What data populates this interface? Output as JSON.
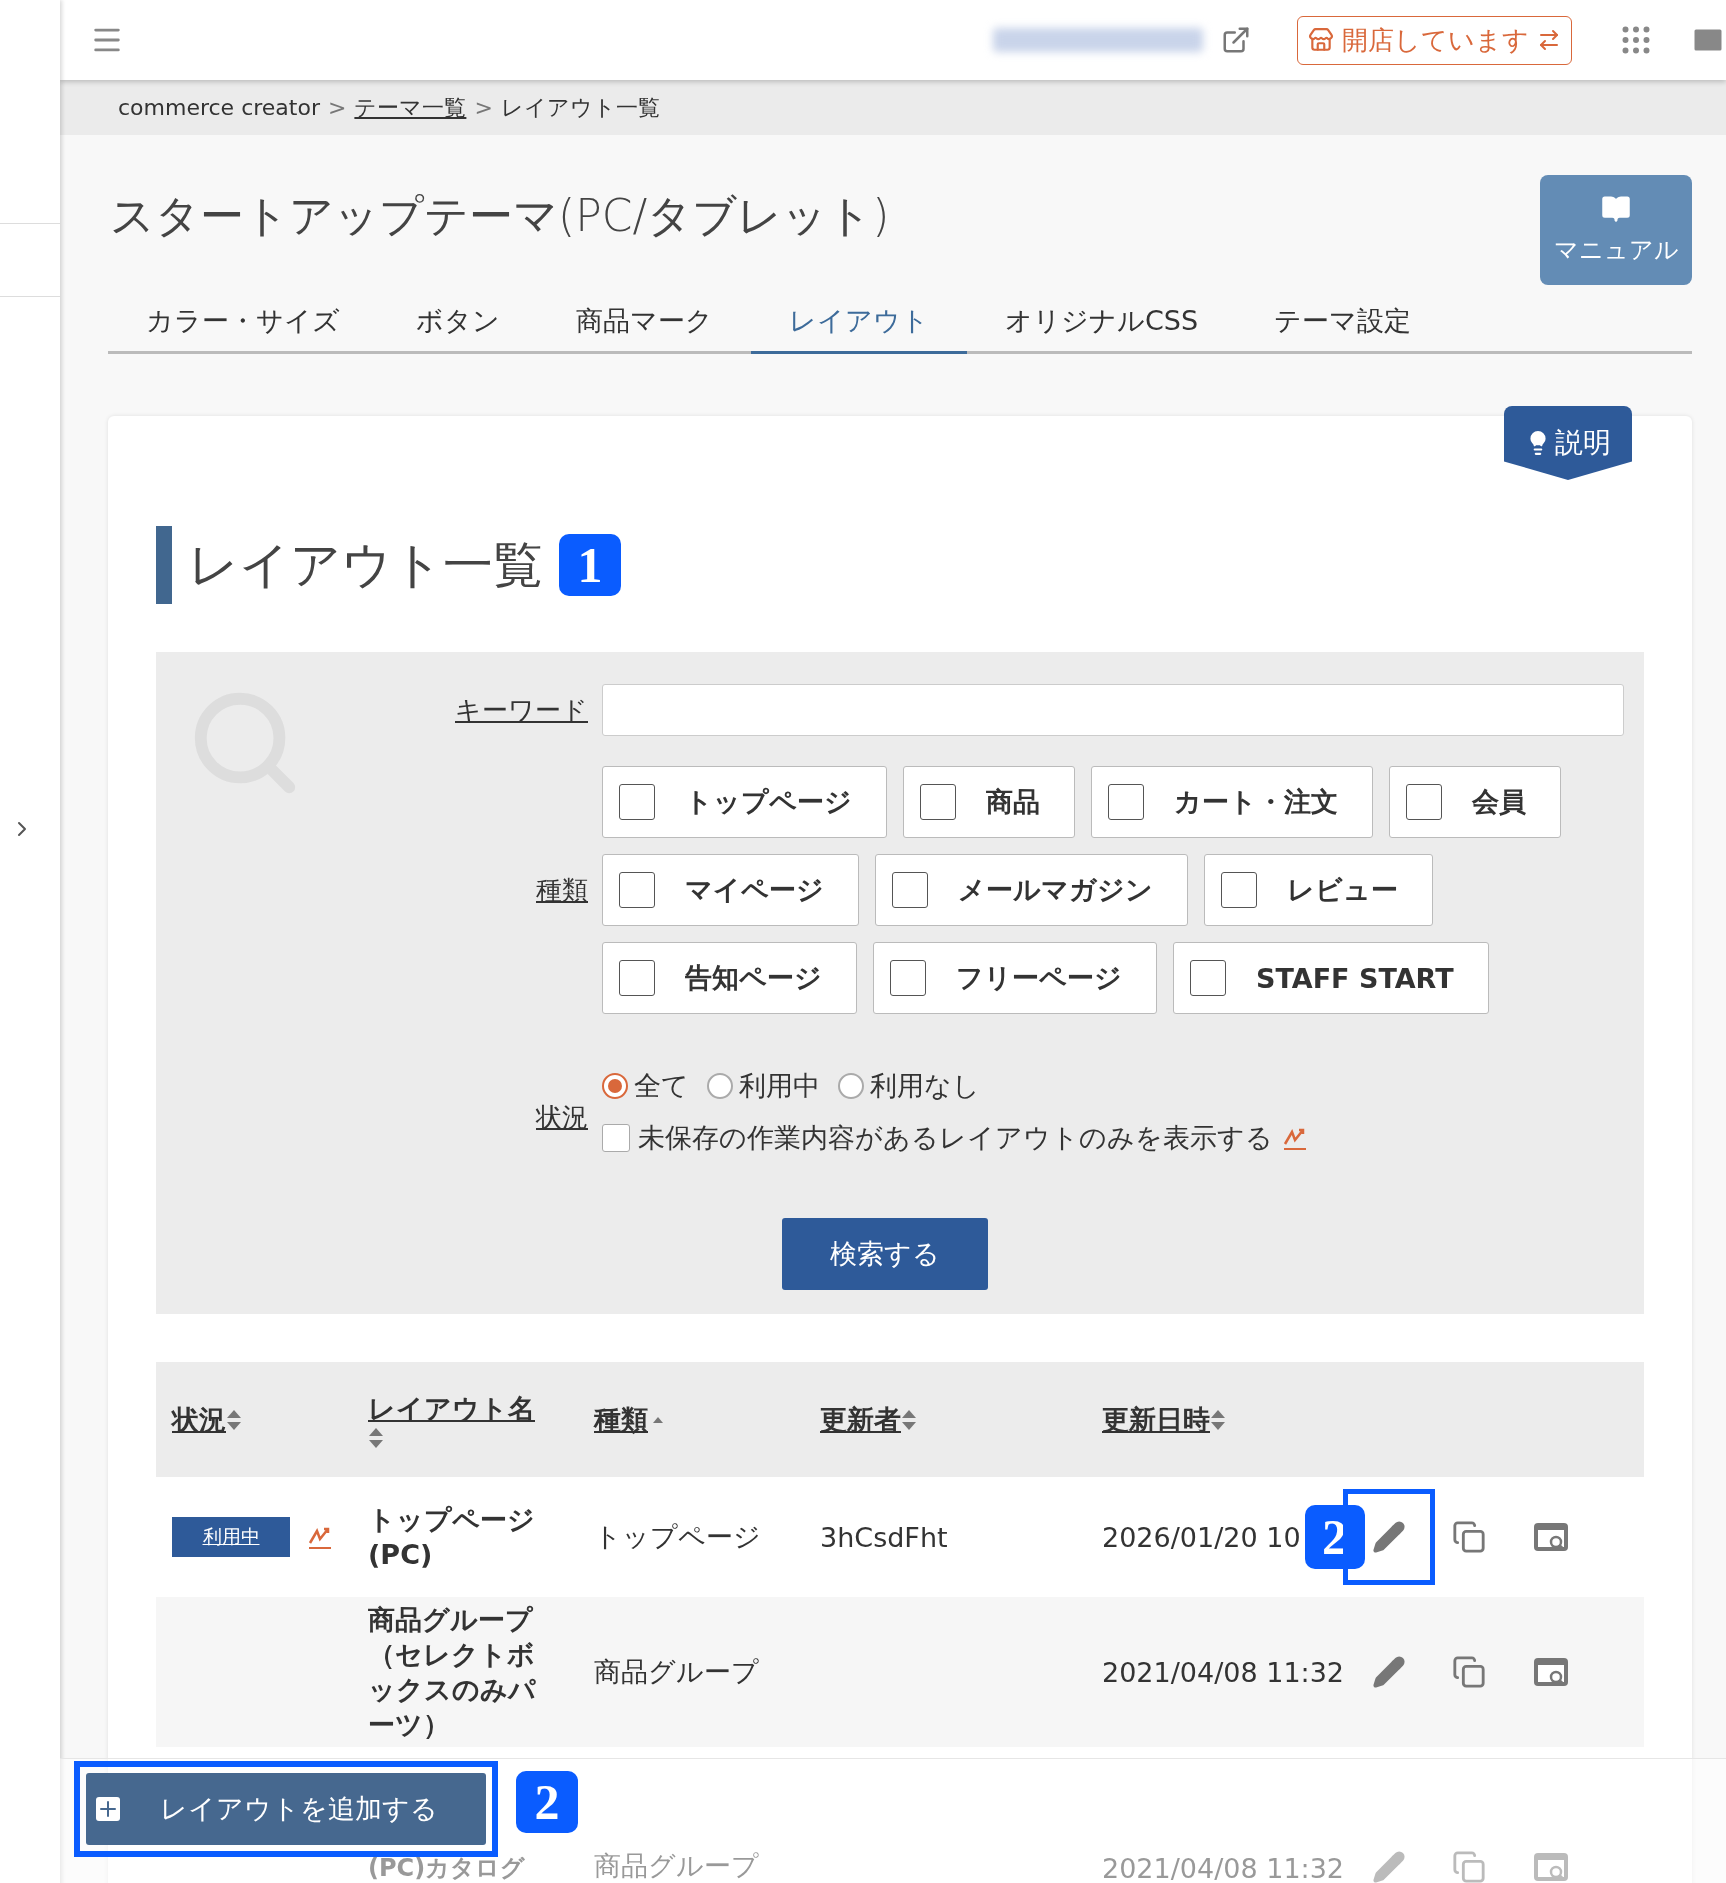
{
  "top_bar": {
    "shop_status": "開店しています"
  },
  "breadcrumb": {
    "separator": ">",
    "items": [
      {
        "label": "commerce creator",
        "link": false
      },
      {
        "label": "テーマ一覧",
        "link": true
      },
      {
        "label": "レイアウト一覧",
        "link": false
      }
    ]
  },
  "page_title": "スタートアップテーマ(PC/タブレット)",
  "manual_button": "マニュアル",
  "tabs": [
    {
      "label": "カラー・サイズ",
      "selected": false
    },
    {
      "label": "ボタン",
      "selected": false
    },
    {
      "label": "商品マーク",
      "selected": false
    },
    {
      "label": "レイアウト",
      "selected": true
    },
    {
      "label": "オリジナルCSS",
      "selected": false
    },
    {
      "label": "テーマ設定",
      "selected": false
    }
  ],
  "help_tab": "説明",
  "section_title": {
    "text": "レイアウト一覧",
    "marker": "1"
  },
  "search": {
    "keyword_label": "キーワード",
    "type_label": "種類",
    "type_option_rows": [
      [
        {
          "label": "トップページ",
          "checked": false
        },
        {
          "label": "商品",
          "checked": false
        },
        {
          "label": "カート・注文",
          "checked": false
        },
        {
          "label": "会員",
          "checked": false
        }
      ],
      [
        {
          "label": "マイページ",
          "checked": false
        },
        {
          "label": "メールマガジン",
          "checked": false
        },
        {
          "label": "レビュー",
          "checked": false
        }
      ],
      [
        {
          "label": "告知ページ",
          "checked": false
        },
        {
          "label": "フリーページ",
          "checked": false
        },
        {
          "label": "STAFF START",
          "checked": false
        }
      ]
    ],
    "status_label": "状況",
    "status_options": [
      {
        "label": "全て",
        "selected": true
      },
      {
        "label": "利用中",
        "selected": false
      },
      {
        "label": "利用なし",
        "selected": false
      }
    ],
    "unsaved_only": {
      "label": "未保存の作業内容があるレイアウトのみを表示する",
      "checked": false
    },
    "submit": "検索する"
  },
  "table": {
    "columns": [
      {
        "label": "状況",
        "sorted_ascending": false
      },
      {
        "label": "レイアウト名",
        "sorted_ascending": false
      },
      {
        "label": "種類",
        "sorted_ascending": true
      },
      {
        "label": "更新者",
        "sorted_ascending": false
      },
      {
        "label": "更新日時",
        "sorted_ascending": false
      }
    ],
    "rows": [
      {
        "status": "利用中",
        "unsaved": true,
        "name": "トップページ(PC)",
        "type": "トップページ",
        "updater": "3hCsdFht",
        "date": "2026/01/20 10",
        "marker": "2",
        "edit_highlighted": true
      },
      {
        "name": "商品グループ（セレクトボックスのみパーツ）",
        "type": "商品グループ",
        "date": "2021/04/08 11:32",
        "unsaved": false,
        "edit_highlighted": false
      },
      {
        "name": "(PC)カタログ",
        "type": "商品グループ",
        "date": "2021/04/08 11:32",
        "unsaved": false,
        "edit_highlighted": false
      }
    ]
  },
  "add_button": {
    "label": "レイアウトを追加する",
    "marker": "2",
    "highlighted": true
  }
}
